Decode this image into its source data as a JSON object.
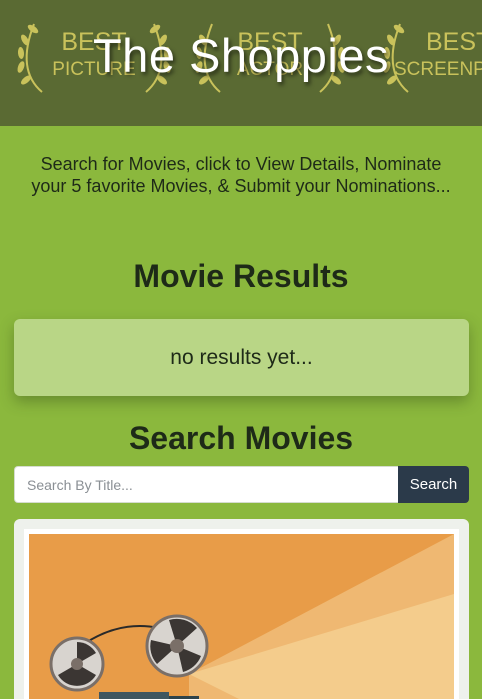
{
  "header": {
    "title": "The Shoppies",
    "awards": [
      {
        "line1": "BEST",
        "line2": "PICTURE"
      },
      {
        "line1": "BEST",
        "line2": "ACTOR"
      },
      {
        "line1": "BEST",
        "line2": "SCREENPLAY"
      }
    ]
  },
  "intro": {
    "text": "Search for Movies, click to View Details, Nominate your 5 favorite Movies, & Submit your Nominations..."
  },
  "results": {
    "heading": "Movie Results",
    "empty_message": "no results yet..."
  },
  "search": {
    "heading": "Search Movies",
    "placeholder": "Search By Title...",
    "value": "",
    "button_label": "Search"
  },
  "colors": {
    "page_bg": "#8bb83d",
    "header_bg": "#5a6a33",
    "results_bg": "#b9d686",
    "button_bg": "#2b3a4a",
    "poster_orange": "#e89c48"
  },
  "poster": {
    "icon": "film-projector-icon"
  }
}
